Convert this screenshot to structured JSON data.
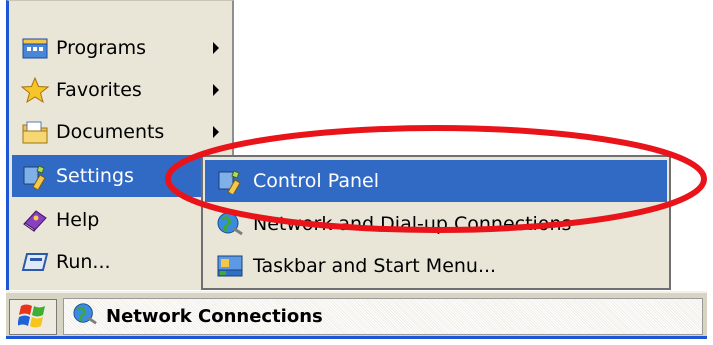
{
  "start_menu": {
    "items": [
      {
        "label": "Programs",
        "icon": "programs-icon",
        "has_submenu": true
      },
      {
        "label": "Favorites",
        "icon": "favorites-star-icon",
        "has_submenu": true
      },
      {
        "label": "Documents",
        "icon": "documents-icon",
        "has_submenu": true
      },
      {
        "label": "Settings",
        "icon": "settings-icon",
        "has_submenu": true,
        "selected": true
      },
      {
        "label": "Help",
        "icon": "help-book-icon",
        "has_submenu": false
      },
      {
        "label": "Run...",
        "icon": "run-icon",
        "has_submenu": false
      }
    ]
  },
  "settings_submenu": {
    "items": [
      {
        "label": "Control Panel",
        "icon": "control-panel-icon",
        "selected": true
      },
      {
        "label": "Network and Dial-up Connections",
        "icon": "network-globe-icon"
      },
      {
        "label": "Taskbar and Start Menu...",
        "icon": "taskbar-icon"
      }
    ]
  },
  "taskbar": {
    "start_icon": "windows-logo-icon",
    "task_button_label": "Network Connections",
    "task_button_icon": "network-globe-icon"
  },
  "colors": {
    "menu_background": "#e9e6d8",
    "selection": "#316ac5",
    "accent_blue": "#1d57d6",
    "annotation_red": "#e8141a"
  }
}
